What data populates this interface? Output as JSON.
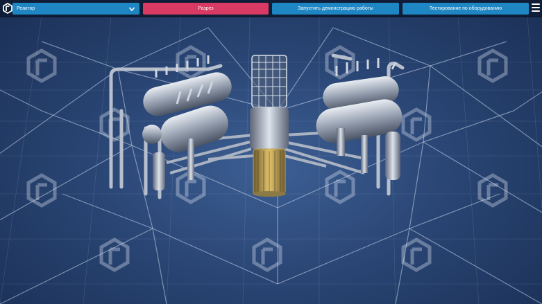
{
  "toolbar": {
    "dropdown_value": "Реактор",
    "cut_label": "Разрез",
    "demo_label": "Запустить демонстрацию работы",
    "test_label": "Тестирование по оборудованию"
  },
  "colors": {
    "background": "#2a4675",
    "toolbar_bg": "#0f1d36",
    "button_blue": "#1f86c4",
    "button_red": "#d83a63",
    "grid_line": "#c6d4ea",
    "watermark": "#e6ecf5"
  },
  "icons": {
    "logo": "brand-logo-icon",
    "dropdown": "chevron-down-icon",
    "menu": "hamburger-menu-icon",
    "watermark": "logo-watermark-icon"
  }
}
